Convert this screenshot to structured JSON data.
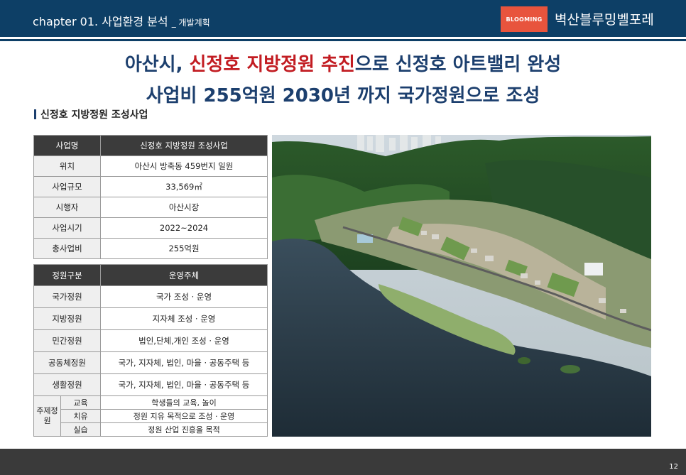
{
  "header": {
    "chapter": "chapter 01. 사업환경 분석",
    "chapter_sub": "_ 개발계획",
    "logo_text": "BLOOMING",
    "brand": "벽산블루밍벨포레"
  },
  "title": {
    "line1_a": "아산시, ",
    "line1_red": "신정호 지방정원 추진",
    "line1_b": "으로 신정호 아트밸리 완성",
    "line2": "사업비 255억원 2030년 까지 국가정원으로 조성"
  },
  "section_head": "신정호 지방정원 조성사업",
  "info_table": {
    "header": [
      "사업명",
      "신정호 지방정원 조성사업"
    ],
    "rows": [
      [
        "위치",
        "아산시 방축동 459번지 일원"
      ],
      [
        "사업규모",
        "33,569㎡"
      ],
      [
        "시행자",
        "아산시장"
      ],
      [
        "사업시기",
        "2022~2024"
      ],
      [
        "총사업비",
        "255억원"
      ]
    ]
  },
  "garden_table": {
    "header": [
      "정원구분",
      "운영주체"
    ],
    "rows": [
      [
        "국가정원",
        "국가 조성 · 운영"
      ],
      [
        "지방정원",
        "지자체 조성 · 운영"
      ],
      [
        "민간정원",
        "법인,단체,개인 조성 · 운영"
      ],
      [
        "공동체정원",
        "국가, 지자체, 법인, 마을 · 공동주택 등"
      ],
      [
        "생활정원",
        "국가, 지자체, 법인, 마을 · 공동주택 등"
      ]
    ],
    "theme_label": "주제정원",
    "theme_rows": [
      [
        "교육",
        "학생들의 교육, 놀이"
      ],
      [
        "치유",
        "정원 지유 목적으로 조성 · 운영"
      ],
      [
        "실습",
        "정원 산업 진흥을 목적"
      ]
    ]
  },
  "page_number": "12",
  "colors": {
    "navy": "#0d3f66",
    "title_navy": "#1c3f6e",
    "red": "#c21c22",
    "logo_orange": "#e8543d",
    "table_header": "#3b3b3b",
    "footer": "#3a3a3a"
  }
}
